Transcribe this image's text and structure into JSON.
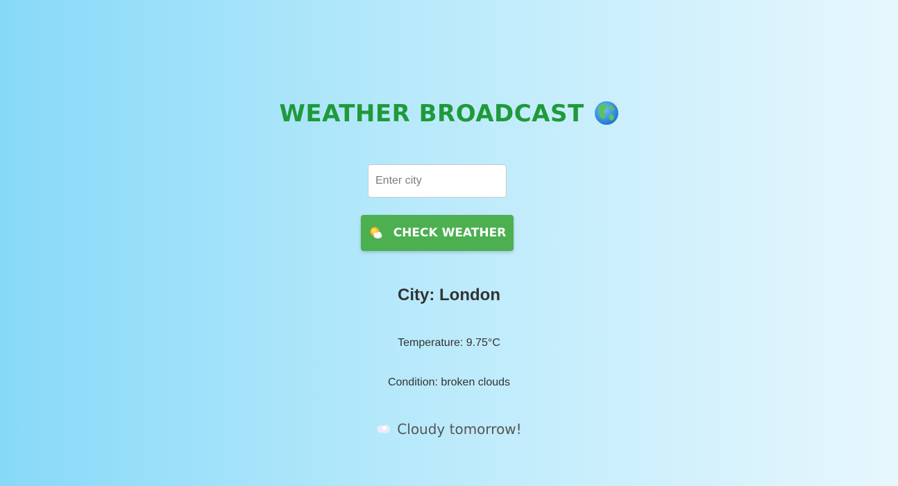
{
  "header": {
    "title": "WEATHER BROADCAST",
    "title_icon": "globe-icon",
    "title_color": "#1f9a3a"
  },
  "search": {
    "placeholder": "Enter city",
    "value": ""
  },
  "button": {
    "label": "CHECK WEATHER",
    "icon": "sun-behind-cloud-icon",
    "color": "#4caf50"
  },
  "result": {
    "city": "City: London",
    "temperature": "Temperature: 9.75°C",
    "condition": "Condition: broken clouds"
  },
  "forecast": {
    "icon": "clouds-icon",
    "text": "Cloudy tomorrow!"
  }
}
